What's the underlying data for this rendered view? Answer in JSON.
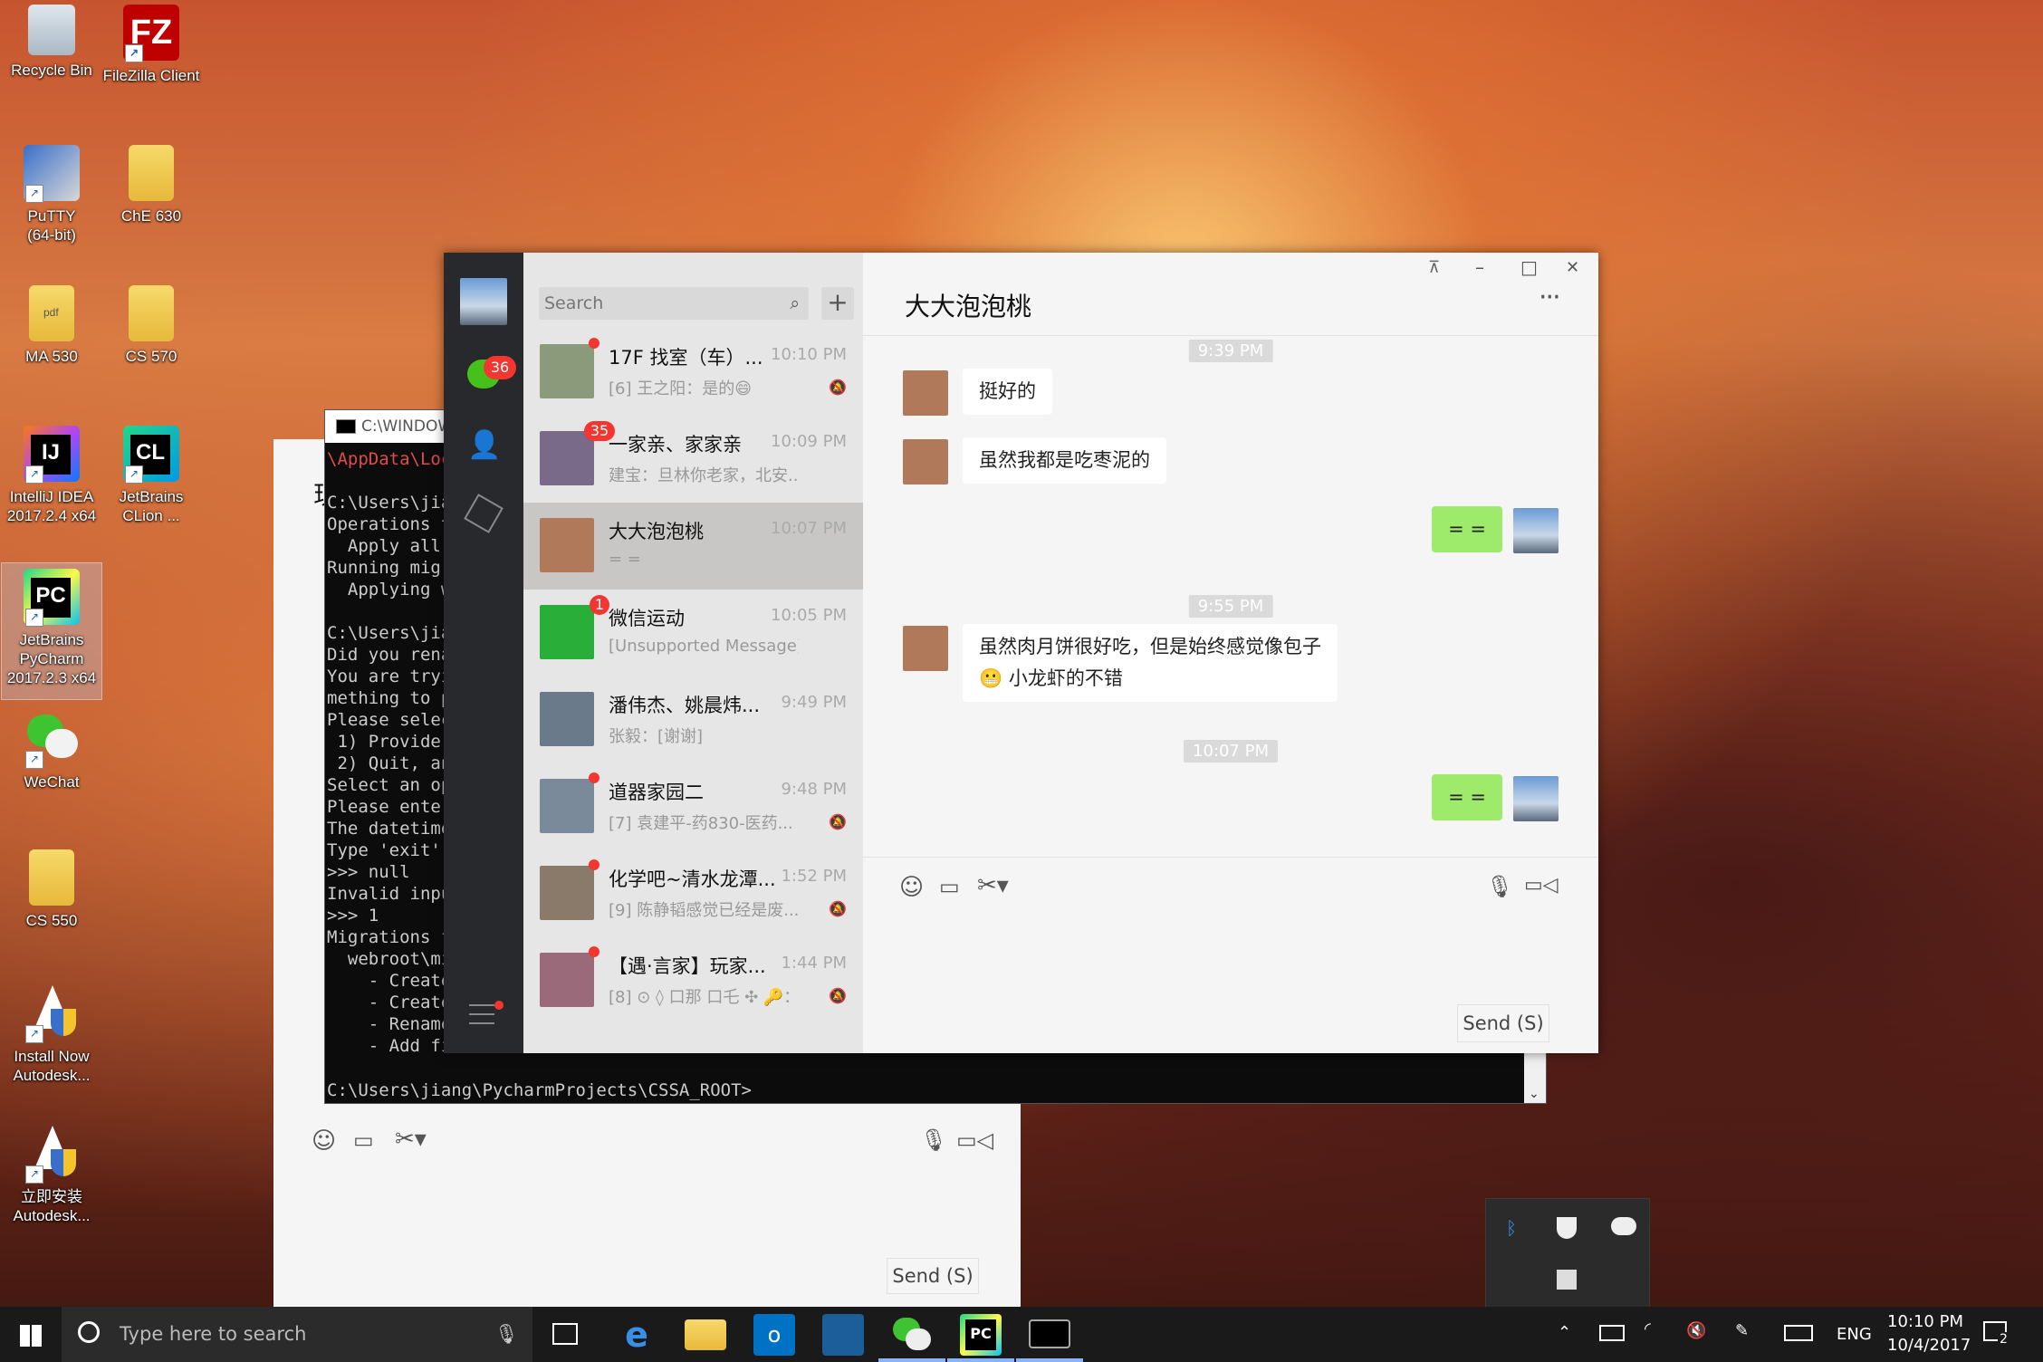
{
  "desktop": {
    "icons": [
      {
        "label1": "Recycle Bin",
        "label2": ""
      },
      {
        "label1": "FileZilla Client",
        "label2": ""
      },
      {
        "label1": "PuTTY",
        "label2": "(64-bit)"
      },
      {
        "label1": "ChE 630",
        "label2": ""
      },
      {
        "label1": "MA 530",
        "label2": ""
      },
      {
        "label1": "CS 570",
        "label2": ""
      },
      {
        "label1": "IntelliJ IDEA",
        "label2": "2017.2.4 x64"
      },
      {
        "label1": "JetBrains",
        "label2": "CLion ..."
      },
      {
        "label1": "JetBrains",
        "label2": "PyCharm",
        "label3": "2017.2.3 x64"
      },
      {
        "label1": "WeChat",
        "label2": ""
      },
      {
        "label1": "CS 550",
        "label2": ""
      },
      {
        "label1": "Install Now",
        "label2": "Autodesk..."
      },
      {
        "label1": "立即安装",
        "label2": "Autodesk..."
      }
    ],
    "icon_glyphs": {
      "filezilla": "FZ",
      "intellij": "IJ",
      "clion": "CL",
      "pycharm": "PC",
      "pdf": "pdf"
    }
  },
  "cmd": {
    "title": "C:\\WINDOW",
    "lines": [
      "\\AppData\\Loc",
      "",
      "C:\\Users\\jia",
      "Operations t",
      "  Apply all",
      "Running migr",
      "  Applying w",
      "",
      "C:\\Users\\jia",
      "Did you rena",
      "You are tryi",
      "mething to p",
      "Please selec",
      " 1) Provide",
      " 2) Quit, an",
      "Select an op",
      "Please enter",
      "The datetime",
      "Type 'exit'",
      ">>> null",
      "Invalid inpu",
      ">>> 1",
      "Migrations f",
      "  webroot\\mi",
      "    - Create",
      "    - Create",
      "    - Rename",
      "    - Add fi"
    ],
    "prompt": "C:\\Users\\jiang\\PycharmProjects\\CSSA_ROOT>"
  },
  "back_window": {
    "title_char": "现",
    "send_label": "Send (S)"
  },
  "wechat": {
    "nav": {
      "chats_badge": "36"
    },
    "search_placeholder": "Search",
    "plus": "+",
    "chats": [
      {
        "name": "17F 找室（车）...",
        "time": "10:10 PM",
        "preview": "[6] 王之阳：是的😄",
        "muted": true,
        "dot": true
      },
      {
        "name": "一家亲、家家亲",
        "time": "10:09 PM",
        "preview": "建宝：旦林你老家，北安...",
        "badge": "35"
      },
      {
        "name": "大大泡泡桃",
        "time": "10:07 PM",
        "preview": "= =",
        "active": true
      },
      {
        "name": "微信运动",
        "time": "10:05 PM",
        "preview": "[Unsupported Message]",
        "badge": "1"
      },
      {
        "name": "潘伟杰、姚晨炜...",
        "time": "9:49 PM",
        "preview": "张毅：[谢谢]"
      },
      {
        "name": "道器家园二",
        "time": "9:48 PM",
        "preview": "[7] 袁建平-药830-医药...",
        "muted": true,
        "dot": true
      },
      {
        "name": "化学吧~清水龙潭...",
        "time": "1:52 PM",
        "preview": "[9] 陈静韬感觉已经是废...",
        "muted": true,
        "dot": true
      },
      {
        "name": "【遇·言家】玩家...",
        "time": "1:44 PM",
        "preview": "[8] ⊙ ◊ 口那 口乇 ✣ 🔑：...",
        "muted": true,
        "dot": true
      }
    ],
    "chat": {
      "title": "大大泡泡桃",
      "more": "···",
      "messages": [
        {
          "type": "time",
          "text": "9:39 PM"
        },
        {
          "type": "in",
          "text": "挺好的"
        },
        {
          "type": "in",
          "text": "虽然我都是吃枣泥的"
        },
        {
          "type": "out",
          "text": "= ="
        },
        {
          "type": "time",
          "text": "9:55 PM"
        },
        {
          "type": "in",
          "text": "虽然肉月饼很好吃，但是始终感觉像包子",
          "text2": "小龙虾的不错"
        },
        {
          "type": "time",
          "text": "10:07 PM"
        },
        {
          "type": "out",
          "text": "= ="
        }
      ],
      "send_label": "Send (S)"
    },
    "window_controls": {
      "pin": "⊼",
      "min": "–",
      "max": "□",
      "close": "✕"
    }
  },
  "taskbar": {
    "search_placeholder": "Type here to search",
    "lang": "ENG",
    "time": "10:10 PM",
    "date": "10/4/2017",
    "notif_count": "2"
  },
  "colors": {
    "wechat_green": "#9eea6a",
    "badge_red": "#f43530",
    "nav_dark": "#28292c"
  }
}
